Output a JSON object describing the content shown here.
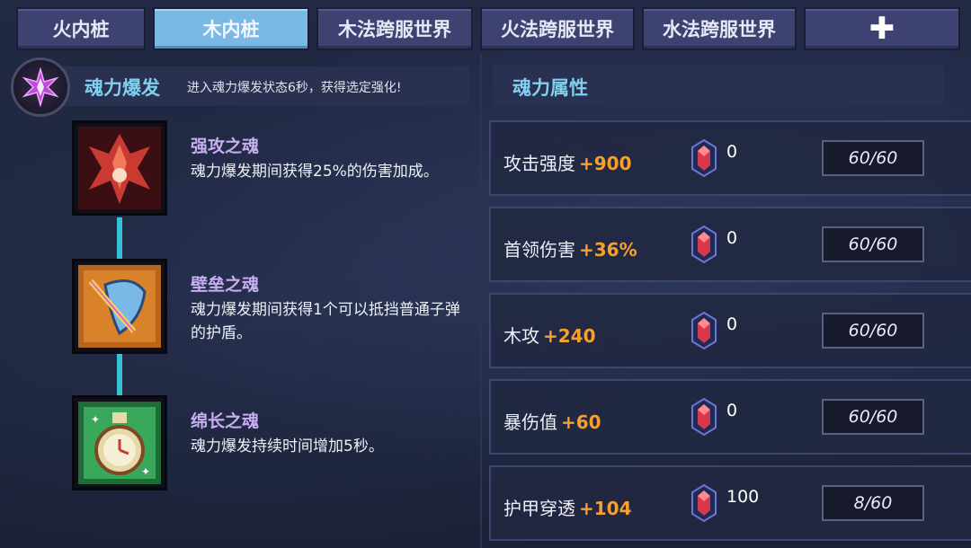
{
  "tabs": [
    {
      "label": "火内桩",
      "active": false
    },
    {
      "label": "木内桩",
      "active": true
    },
    {
      "label": "木法跨服世界",
      "active": false
    },
    {
      "label": "火法跨服世界",
      "active": false
    },
    {
      "label": "水法跨服世界",
      "active": false
    },
    {
      "label": "✚",
      "active": false
    }
  ],
  "skill": {
    "title": "魂力爆发",
    "description": "进入魂力爆发状态6秒，获得选定强化!",
    "icon": "soul-burst-icon"
  },
  "souls": [
    {
      "name": "强攻之魂",
      "text": "魂力爆发期间获得25%的伤害加成。",
      "icon": "flame-claw-icon",
      "color": "#c83a32"
    },
    {
      "name": "壁垒之魂",
      "text": "魂力爆发期间获得1个可以抵挡普通子弹的护盾。",
      "icon": "shield-sword-icon",
      "color": "#e08a2a"
    },
    {
      "name": "绵长之魂",
      "text": "魂力爆发持续时间增加5秒。",
      "icon": "clock-bottle-icon",
      "color": "#3aa85a"
    }
  ],
  "attributes_panel": {
    "title": "魂力属性",
    "rows": [
      {
        "name": "攻击强度",
        "bonus": "+900",
        "count": "0",
        "progress": "60/60"
      },
      {
        "name": "首领伤害",
        "bonus": "+36%",
        "count": "0",
        "progress": "60/60"
      },
      {
        "name": "木攻",
        "bonus": "+240",
        "count": "0",
        "progress": "60/60"
      },
      {
        "name": "暴伤值",
        "bonus": "+60",
        "count": "0",
        "progress": "60/60"
      },
      {
        "name": "护甲穿透",
        "bonus": "+104",
        "count": "100",
        "progress": "8/60"
      }
    ]
  },
  "colors": {
    "accent_cyan": "#7fd0f0",
    "bonus_orange": "#f5a030",
    "soul_name_purple": "#c7aef0",
    "active_tab": "#79b9e4"
  }
}
